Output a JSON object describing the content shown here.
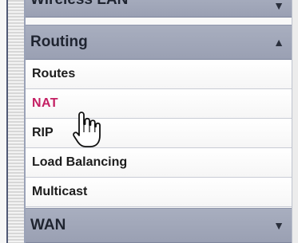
{
  "sections": {
    "wireless_lan": {
      "label": "Wireless LAN",
      "arrow": "▼"
    },
    "routing": {
      "label": "Routing",
      "arrow": "▲"
    },
    "wan": {
      "label": "WAN",
      "arrow": "▼"
    }
  },
  "routing_items": [
    {
      "label": "Routes"
    },
    {
      "label": "NAT"
    },
    {
      "label": "RIP"
    },
    {
      "label": "Load Balancing"
    },
    {
      "label": "Multicast"
    }
  ],
  "colors": {
    "header": "#9aa0b3",
    "active_text": "#c41f63",
    "item_text": "#1c1c1c"
  },
  "icons": {
    "cursor": "hand-pointer-icon"
  }
}
